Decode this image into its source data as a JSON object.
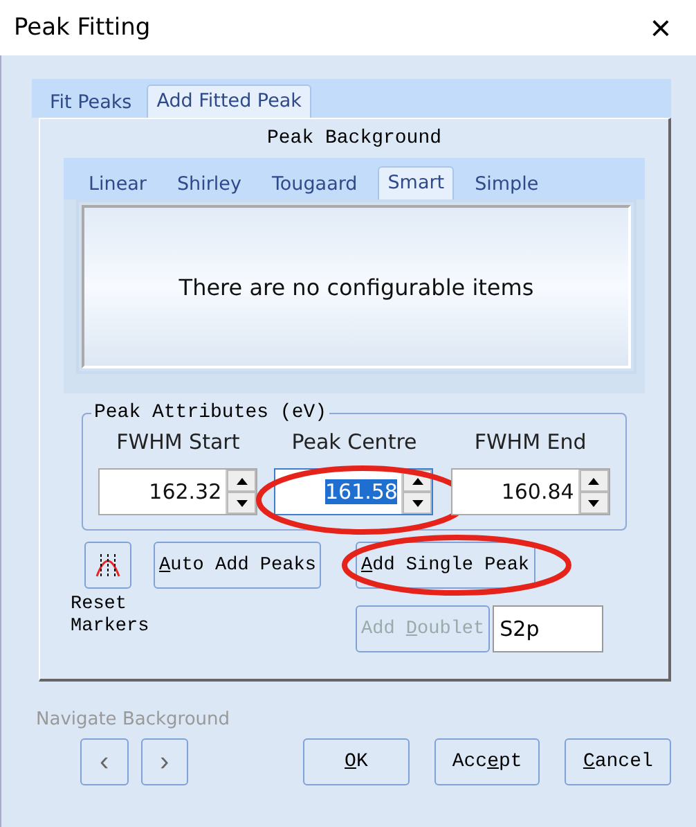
{
  "window": {
    "title": "Peak Fitting",
    "close": "×"
  },
  "tabs": [
    {
      "label": "Fit Peaks",
      "selected": false
    },
    {
      "label": "Add Fitted Peak",
      "selected": true
    }
  ],
  "peak_background": {
    "title": "Peak Background",
    "tabs": [
      {
        "label": "Linear",
        "selected": false
      },
      {
        "label": "Shirley",
        "selected": false
      },
      {
        "label": "Tougaard",
        "selected": false
      },
      {
        "label": "Smart",
        "selected": true
      },
      {
        "label": "Simple",
        "selected": false
      }
    ],
    "message": "There are no configurable items"
  },
  "peak_attributes": {
    "title": "Peak Attributes (eV)",
    "fields": [
      {
        "label": "FWHM Start",
        "value": "162.32",
        "selected": false,
        "circled": false
      },
      {
        "label": "Peak Centre",
        "value": "161.58",
        "selected": true,
        "circled": true
      },
      {
        "label": "FWHM End",
        "value": "160.84",
        "selected": false,
        "circled": false
      }
    ]
  },
  "reset_markers": {
    "label": "Reset Markers"
  },
  "actions": [
    {
      "key": "A",
      "post": "uto Add Peaks",
      "disabled": false,
      "circled": false
    },
    {
      "key": "A",
      "post": "dd Single Peak",
      "disabled": false,
      "circled": true
    }
  ],
  "doublet": {
    "pre": "Add ",
    "key": "D",
    "post": "oublet",
    "disabled": true,
    "value": "S2p"
  },
  "navigate": {
    "label": "Navigate Background",
    "prev": "‹",
    "next": "›"
  },
  "buttons": [
    {
      "key": "O",
      "post": "K"
    },
    {
      "pre": "Acc",
      "key": "e",
      "post": "pt"
    },
    {
      "key": "C",
      "post": "ancel"
    }
  ]
}
